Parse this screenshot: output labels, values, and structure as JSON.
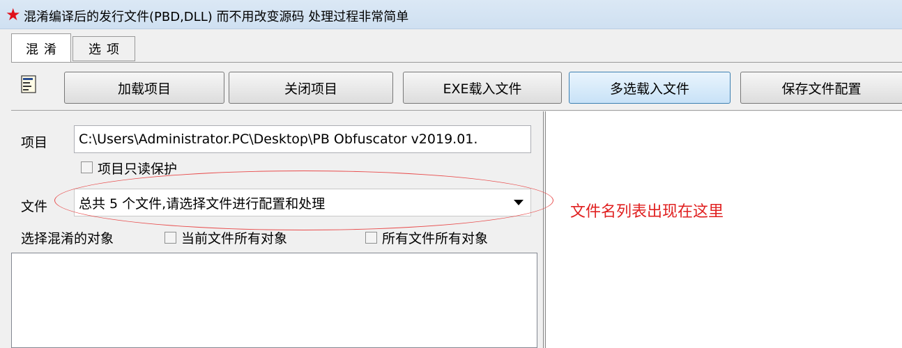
{
  "window": {
    "title": "混淆编译后的发行文件(PBD,DLL) 而不用改变源码 处理过程非常简单",
    "icon": "red-star-icon"
  },
  "tabs": [
    {
      "label": "混淆",
      "active": true
    },
    {
      "label": "选项",
      "active": false
    }
  ],
  "toolbar": {
    "icon": "form-icon",
    "buttons": [
      {
        "label": "加载项目"
      },
      {
        "label": "关闭项目"
      },
      {
        "label": "EXE载入文件"
      },
      {
        "label": "多选载入文件"
      },
      {
        "label": "保存文件配置"
      }
    ]
  },
  "project": {
    "label": "项目",
    "value": "C:\\Users\\Administrator.PC\\Desktop\\PB Obfuscator v2019.01.",
    "readonly_label": "项目只读保护"
  },
  "file": {
    "label": "文件",
    "value": "总共 5 个文件,请选择文件进行配置和处理"
  },
  "objects": {
    "label": "选择混淆的对象",
    "current_file_all": "当前文件所有对象",
    "all_files_all": "所有文件所有对象"
  },
  "annotation": {
    "text": "文件名列表出现在这里",
    "color": "#e02020"
  }
}
